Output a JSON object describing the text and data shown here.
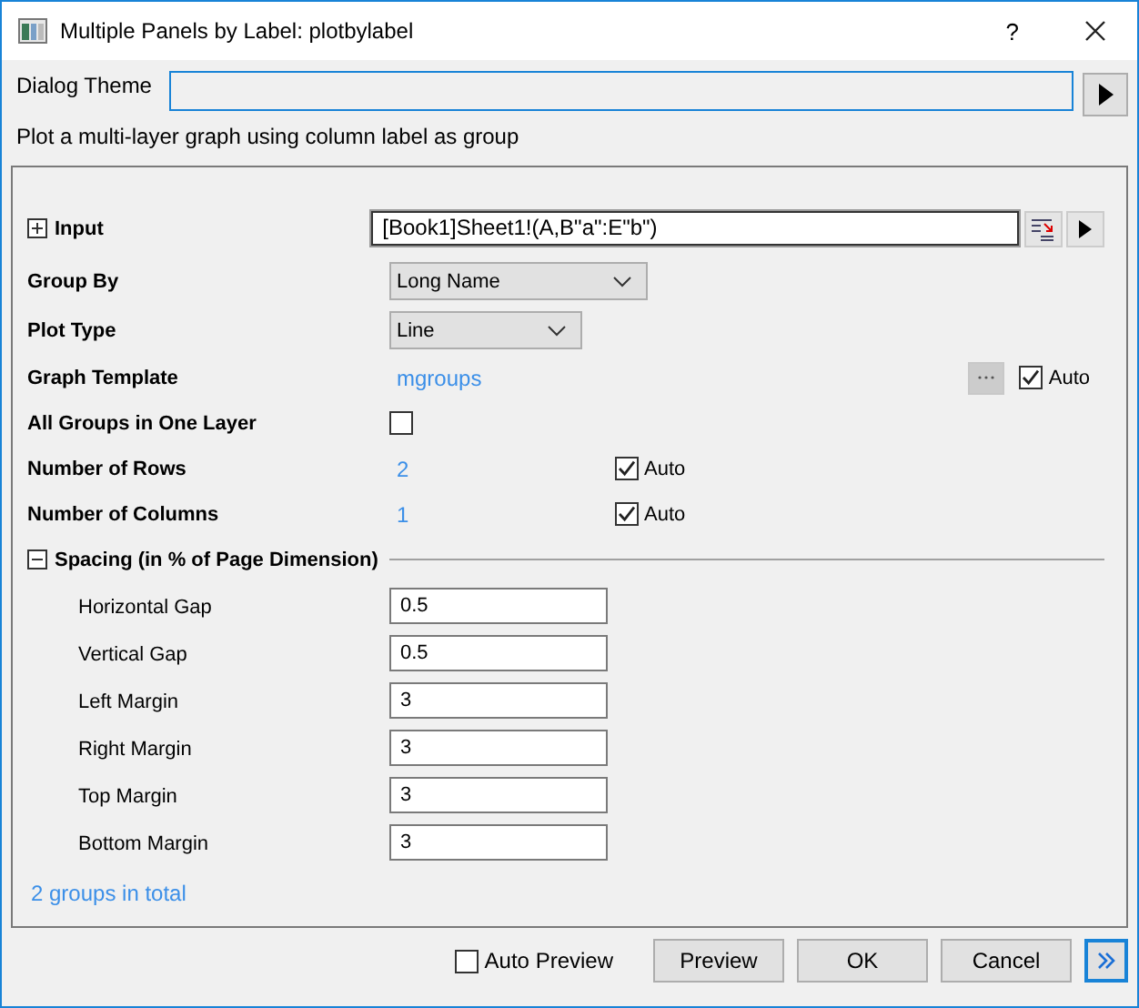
{
  "window": {
    "title": "Multiple Panels by Label: plotbylabel",
    "help": "?"
  },
  "dialog_theme": {
    "label": "Dialog Theme"
  },
  "description": "Plot a multi-layer graph using column label as group",
  "rows": [
    {
      "kind": "input",
      "label": "Input",
      "expanded": false,
      "value": "[Book1]Sheet1!(A,B\"a\":E\"b\")"
    },
    {
      "kind": "dropdown",
      "label": "Group By",
      "value": "Long Name"
    },
    {
      "kind": "dropdown",
      "label": "Plot Type",
      "value": "Line"
    },
    {
      "kind": "template",
      "label": "Graph Template",
      "value": "mgroups",
      "auto": {
        "label": "Auto",
        "checked": true
      }
    },
    {
      "kind": "checkbox",
      "label": "All Groups in One Layer",
      "checked": false
    },
    {
      "kind": "count",
      "label": "Number of Rows",
      "value": "2",
      "auto": {
        "label": "Auto",
        "checked": true
      }
    },
    {
      "kind": "count",
      "label": "Number of Columns",
      "value": "1",
      "auto": {
        "label": "Auto",
        "checked": true
      }
    }
  ],
  "spacing": {
    "label": "Spacing (in % of Page Dimension)",
    "expanded": true,
    "fields": [
      {
        "label": "Horizontal Gap",
        "value": "0.5"
      },
      {
        "label": "Vertical Gap",
        "value": "0.5"
      },
      {
        "label": "Left Margin",
        "value": "3"
      },
      {
        "label": "Right Margin",
        "value": "3"
      },
      {
        "label": "Top Margin",
        "value": "3"
      },
      {
        "label": "Bottom Margin",
        "value": "3"
      }
    ]
  },
  "summary": "2 groups in total",
  "footer": {
    "auto_preview": {
      "label": "Auto Preview",
      "checked": false
    },
    "buttons": [
      "Preview",
      "OK",
      "Cancel"
    ]
  }
}
